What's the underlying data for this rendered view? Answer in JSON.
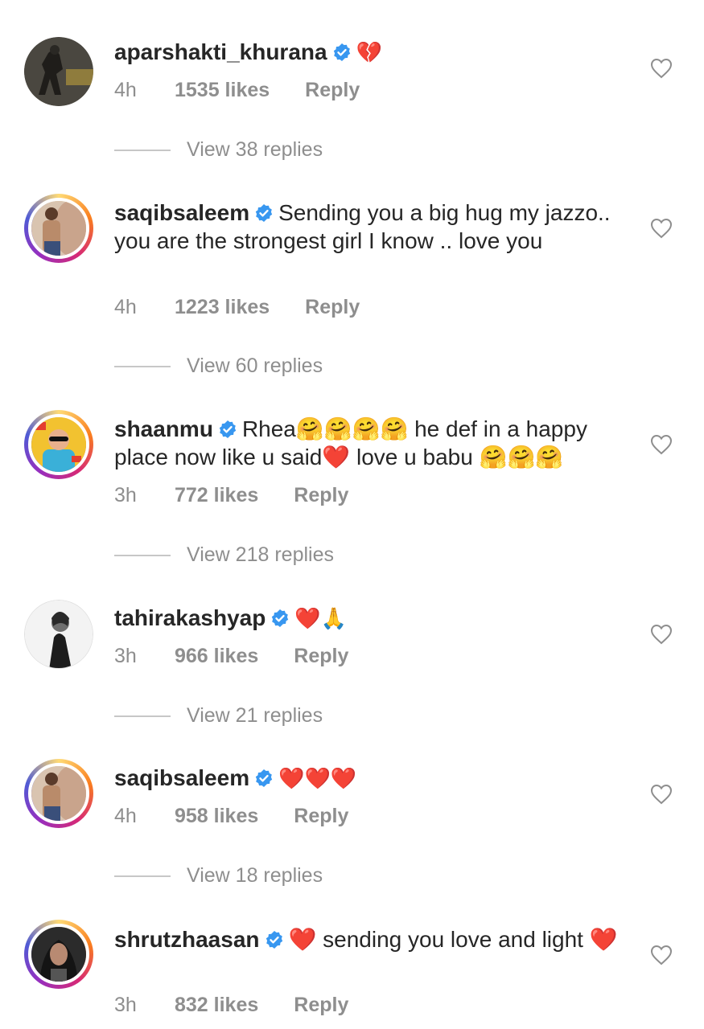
{
  "colors": {
    "verified": "#3897f0",
    "heart": "#e0182d",
    "meta_gray": "#8e8e8e"
  },
  "comments": [
    {
      "username": "aparshakti_khurana",
      "text": "💔",
      "time": "4h",
      "likes": "1535 likes",
      "reply": "Reply",
      "view_replies": "View 38 replies",
      "avatar": "photo"
    },
    {
      "username": "saqibsaleem",
      "text": "Sending you a big hug my jazzo.. you are the strongest girl I know .. love you",
      "time": "4h",
      "likes": "1223 likes",
      "reply": "Reply",
      "view_replies": "View 60 replies",
      "avatar": "story-ring"
    },
    {
      "username": "shaanmu",
      "text": "Rhea🤗🤗🤗🤗 he def in a happy place now like u said❤️ love u babu 🤗🤗🤗",
      "time": "3h",
      "likes": "772 likes",
      "reply": "Reply",
      "view_replies": "View 218 replies",
      "avatar": "story-ring"
    },
    {
      "username": "tahirakashyap",
      "text": "❤️🙏",
      "time": "3h",
      "likes": "966 likes",
      "reply": "Reply",
      "view_replies": "View 21 replies",
      "avatar": "photo"
    },
    {
      "username": "saqibsaleem",
      "text": "❤️❤️❤️",
      "time": "4h",
      "likes": "958 likes",
      "reply": "Reply",
      "view_replies": "View 18 replies",
      "avatar": "story-ring"
    },
    {
      "username": "shrutzhaasan",
      "text": "❤️ sending you love and light ❤️",
      "time": "3h",
      "likes": "832 likes",
      "reply": "Reply",
      "view_replies": "",
      "avatar": "story-ring"
    }
  ]
}
